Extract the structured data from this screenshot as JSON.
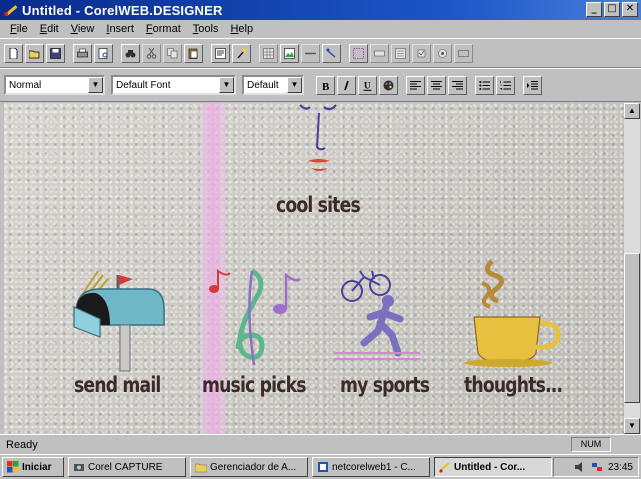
{
  "window": {
    "title": "Untitled - CorelWEB.DESIGNER",
    "controls": {
      "minimize": "_",
      "maximize": "□",
      "close": "✕"
    }
  },
  "menu": [
    "File",
    "Edit",
    "View",
    "Insert",
    "Format",
    "Tools",
    "Help"
  ],
  "toolbar": {
    "paragraph_style": "Normal",
    "font_name": "Default Font",
    "font_size": "Default"
  },
  "page": {
    "captions": {
      "cool_sites": "cool sites",
      "send_mail": "send mail",
      "music_picks": "music picks",
      "my_sports": "my sports",
      "thoughts": "thoughts..."
    }
  },
  "status": {
    "text": "Ready",
    "num": "NUM"
  },
  "taskbar": {
    "start_label": "Iniciar",
    "items": [
      {
        "label": "Corel CAPTURE"
      },
      {
        "label": "Gerenciador de A..."
      },
      {
        "label": "netcorelweb1 - C..."
      },
      {
        "label": "Untitled - Cor..."
      }
    ],
    "clock": "23:45"
  },
  "colors": {
    "titlebar": "#0a2a8c",
    "face_lines": "#4a3f9a",
    "lips": "#e0443c",
    "mailbox": "#6fb8c8",
    "flag": "#d83a3a",
    "clef": "#5cb88c",
    "note": "#a070c8",
    "runner": "#7a70c0",
    "cup": "#e8c040",
    "steam": "#b58a3a"
  }
}
